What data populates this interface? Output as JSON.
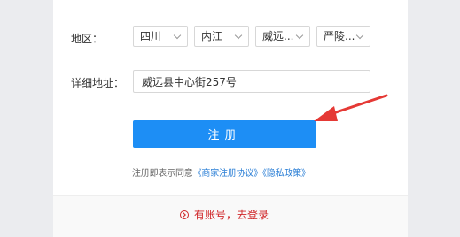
{
  "form": {
    "cropped_top_text": "",
    "region": {
      "label": "地区：",
      "province": "四川",
      "city": "内江",
      "district": "威远...",
      "town": "严陵..."
    },
    "address": {
      "label": "详细地址：",
      "value": "威远县中心街257号"
    },
    "submit_label": "注册",
    "agreement": {
      "prefix": "注册即表示同意",
      "merchant_agreement": "《商家注册协议》",
      "privacy_policy": "《隐私政策》"
    }
  },
  "footer": {
    "login_link": "有账号，去登录"
  },
  "colors": {
    "primary": "#1d8ef5",
    "link": "#2b7fd6",
    "accent_red": "#d0272a",
    "annotation_arrow": "#e53935"
  }
}
